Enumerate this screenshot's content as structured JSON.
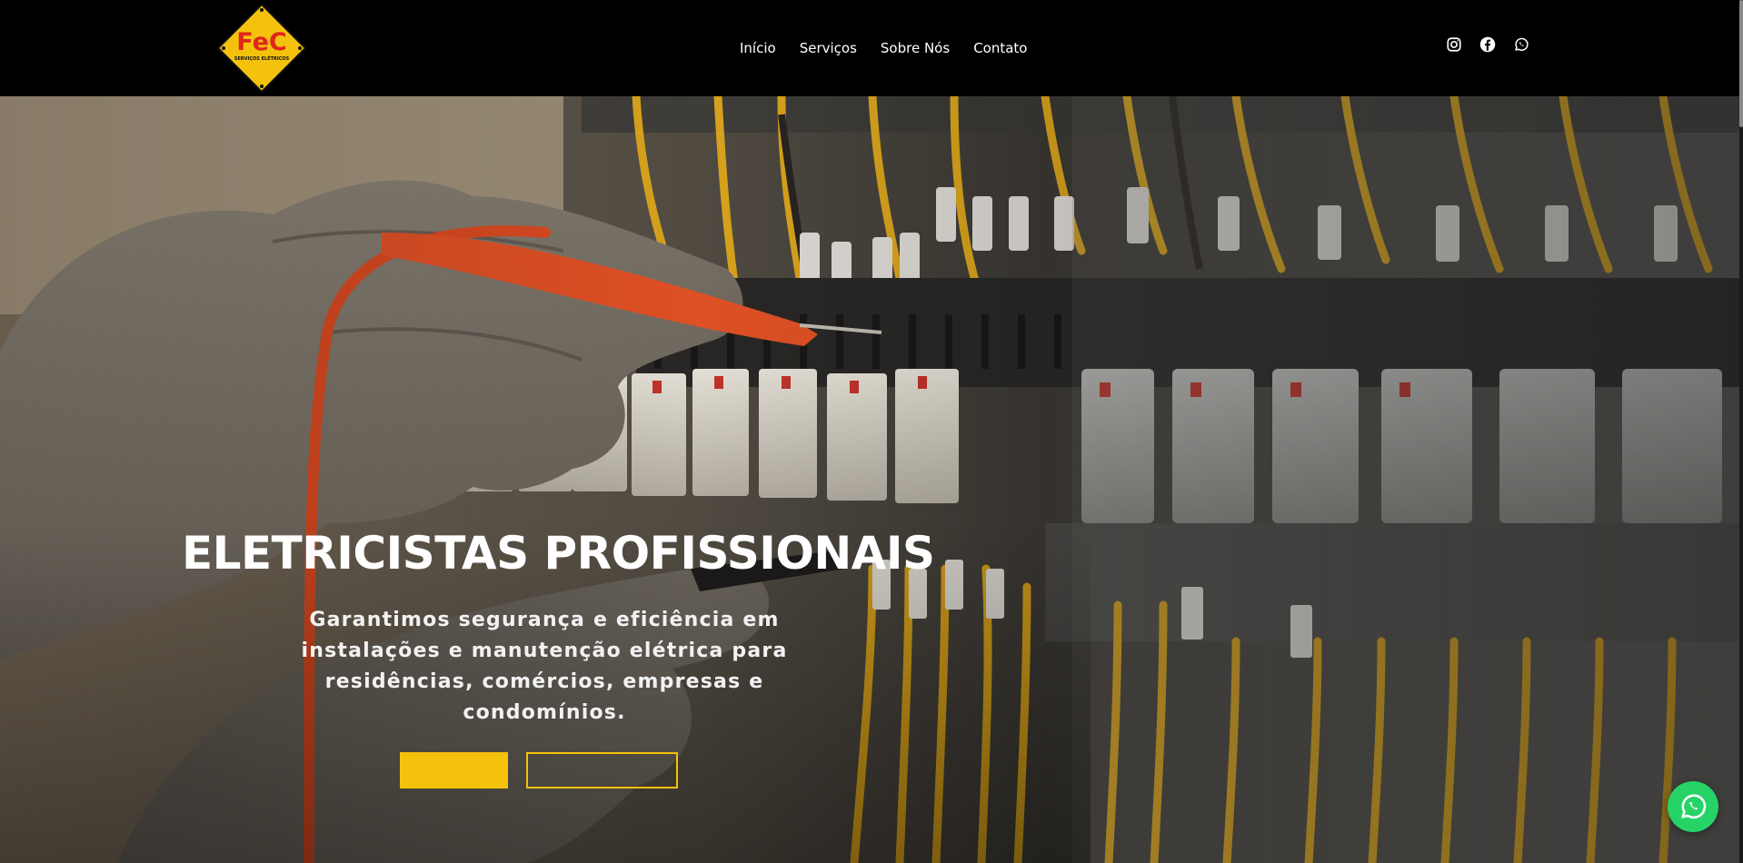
{
  "header": {
    "logo": {
      "icon": "fec-diamond-logo",
      "brand": "FeC",
      "tagline": "SERVIÇOS ELÉTRICOS",
      "colors": {
        "diamond": "#f4c20d",
        "brand_text": "#e1251b",
        "border": "#000000"
      }
    },
    "nav": [
      {
        "label": "Início"
      },
      {
        "label": "Serviços"
      },
      {
        "label": "Sobre Nós"
      },
      {
        "label": "Contato"
      }
    ],
    "socials": [
      {
        "icon": "instagram-icon"
      },
      {
        "icon": "facebook-icon"
      },
      {
        "icon": "whatsapp-icon"
      }
    ]
  },
  "hero": {
    "image": "electrician-gloved-hands-testing-panel-with-multimeter",
    "title": "ELETRICISTAS PROFISSIONAIS",
    "subtitle": "Garantimos segurança e eficiência em instalações e manutenção elétrica para residências, comércios, empresas e condomínios.",
    "buttons": [
      {
        "label": "",
        "style": "filled"
      },
      {
        "label": "",
        "style": "outline"
      }
    ]
  },
  "floating_whatsapp": {
    "icon": "whatsapp-icon"
  },
  "colors": {
    "header_bg": "#000000",
    "accent_yellow": "#f4c20d",
    "whatsapp_green": "#25d366",
    "text": "#ffffff"
  }
}
